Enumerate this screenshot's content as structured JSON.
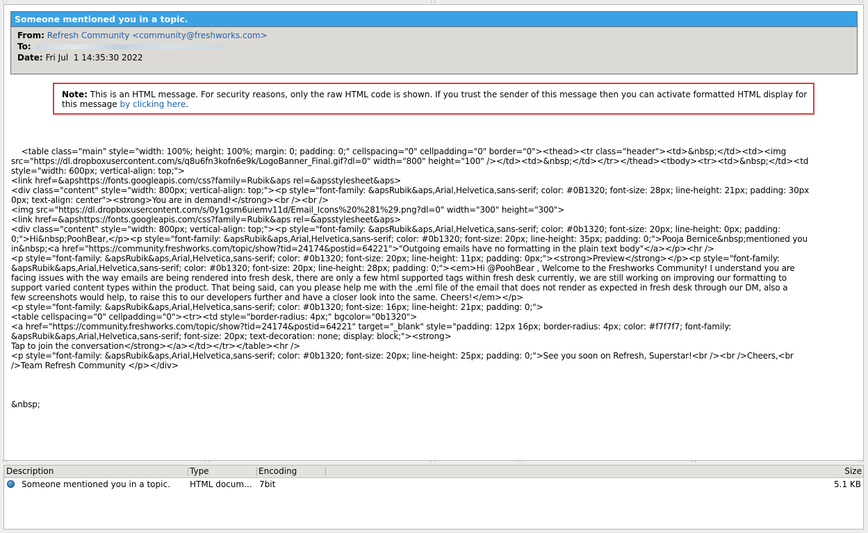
{
  "message": {
    "subject": "Someone mentioned you in a topic.",
    "from_label": "From:",
    "from_value": "Refresh Community <community@freshworks.com>",
    "to_label": "To:",
    "date_label": "Date:",
    "date_value": "Fri Jul  1 14:35:30 2022"
  },
  "note": {
    "label": "Note:",
    "text": " This is an HTML message. For security reasons, only the raw HTML code is shown. If you trust the sender of this message then you can activate formatted HTML display for this message ",
    "link": "by clicking here",
    "end": "."
  },
  "raw_html": "<table class=\"main\" style=\"width: 100%; height: 100%; margin: 0; padding: 0;\" cellspacing=\"0\" cellpadding=\"0\" border=\"0\"><thead><tr class=\"header\"><td>&nbsp;</td><td><img\nsrc=\"https://dl.dropboxusercontent.com/s/q8u6fn3kofn6e9k/LogoBanner_Final.gif?dl=0\" width=\"800\" height=\"100\" /></td><td>&nbsp;</td></tr></thead><tbody><tr><td>&nbsp;</td><td\nstyle=\"width: 600px; vertical-align: top;\">\n<link href=&apshttps://fonts.googleapis.com/css?family=Rubik&aps rel=&apsstylesheet&aps>\n<div class=\"content\" style=\"width: 800px; vertical-align: top;\"><p style=\"font-family: &apsRubik&aps,Arial,Helvetica,sans-serif; color: #0B1320; font-size: 28px; line-height: 21px; padding: 30px\n0px; text-align: center\"><strong>You are in demand!</strong><br /><br />\n<img src=\"https://dl.dropboxusercontent.com/s/0y1gsm6uiemv11d/Email_Icons%20%281%29.png?dl=0\" width=\"300\" height=\"300\">\n<link href=&apshttps://fonts.googleapis.com/css?family=Rubik&aps rel=&apsstylesheet&aps>\n<div class=\"content\" style=\"width: 800px; vertical-align: top;\"><p style=\"font-family: &apsRubik&aps,Arial,Helvetica,sans-serif; color: #0b1320; font-size: 20px; line-height: 0px; padding:\n0;\">Hi&nbsp;PoohBear,</p><p style=\"font-family: &apsRubik&aps,Arial,Helvetica,sans-serif; color: #0b1320; font-size: 20px; line-height: 35px; padding: 0;\">Pooja Bernice&nbsp;mentioned you\nin&nbsp;<a href=\"https://community.freshworks.com/topic/show?tid=24174&postid=64221\">\"Outgoing emails have no formatting in the plain text body\"</a></p><hr />\n<p style=\"font-family: &apsRubik&aps,Arial,Helvetica,sans-serif; color: #0b1320; font-size: 20px; line-height: 11px; padding: 0px;\"><strong>Preview</strong></p><p style=\"font-family:\n&apsRubik&aps,Arial,Helvetica,sans-serif; color: #0b1320; font-size: 20px; line-height: 28px; padding: 0;\"><em>Hi @PoohBear , Welcome to the Freshworks Community! I understand you are\nfacing issues with the way emails are being rendered into fresh desk, there are only a few html supported tags within fresh desk currently, we are still working on improving our formatting to\nsupport varied content types within the product. That being said, can you please help me with the .eml file of the email that does not render as expected in fresh desk through our DM, also a\nfew screenshots would help, to raise this to our developers further and have a closer look into the same. Cheers!</em></p>\n<p style=\"font-family: &apsRubik&aps,Arial,Helvetica,sans-serif; color: #0b1320; font-size: 16px; line-height: 21px; padding: 0;\">\n<table cellspacing=\"0\" cellpadding=\"0\"><tr><td style=\"border-radius: 4px;\" bgcolor=\"0b1320\">\n<a href=\"https://community.freshworks.com/topic/show?tid=24174&postid=64221\" target=\"_blank\" style=\"padding: 12px 16px; border-radius: 4px; color: #f7f7f7; font-family:\n&apsRubik&aps,Arial,Helvetica,sans-serif; font-size: 20px; text-decoration: none; display: block;\"><strong>\nTap to join the conversation</strong></a></td></tr></table><hr />\n<p style=\"font-family: &apsRubik&aps,Arial,Helvetica,sans-serif; color: #0b1320; font-size: 20px; line-height: 25px; padding: 0;\">See you soon on Refresh, Superstar!<br /><br />Cheers,<br\n/>Team Refresh Community </p></div>",
  "raw_tail": "&nbsp;",
  "attachments": {
    "columns": {
      "description": "Description",
      "type": "Type",
      "encoding": "Encoding",
      "size": "Size"
    },
    "rows": [
      {
        "icon": "html-document-icon",
        "description": "Someone mentioned you in a topic.",
        "type": "HTML docum...",
        "encoding": "7bit",
        "size": "5.1 KB"
      }
    ]
  }
}
